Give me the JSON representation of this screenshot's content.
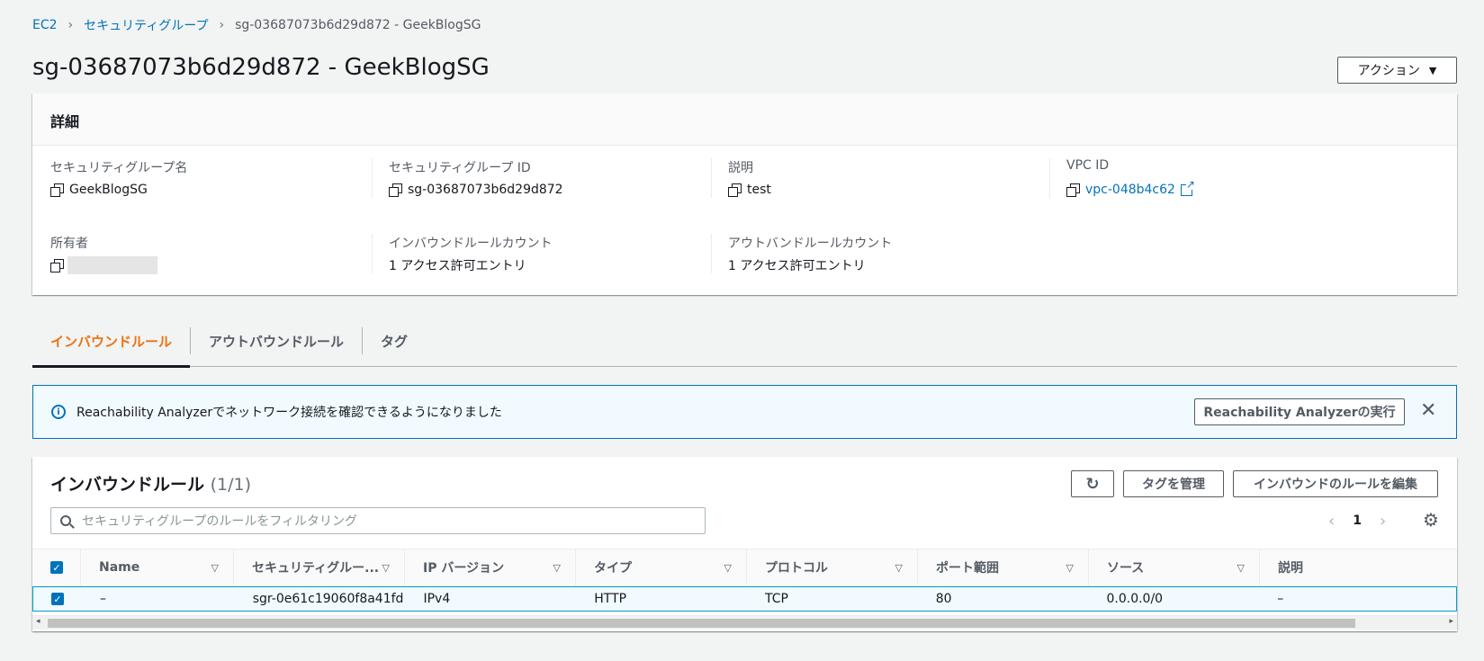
{
  "breadcrumb": {
    "root": "EC2",
    "parent": "セキュリティグループ",
    "current": "sg-03687073b6d29d872 - GeekBlogSG"
  },
  "page": {
    "title": "sg-03687073b6d29d872 - GeekBlogSG",
    "action_label": "アクション"
  },
  "details": {
    "heading": "詳細",
    "fields": [
      {
        "key": "セキュリティグループ名",
        "value": "GeekBlogSG"
      },
      {
        "key": "セキュリティグループ ID",
        "value": "sg-03687073b6d29d872"
      },
      {
        "key": "説明",
        "value": "test"
      },
      {
        "key": "VPC ID",
        "value": "vpc-048b4c62"
      },
      {
        "key": "所有者",
        "value": ""
      },
      {
        "key": "インバウンドルールカウント",
        "value": "1 アクセス許可エントリ"
      },
      {
        "key": "アウトバンドルールカウント",
        "value": "1 アクセス許可エントリ"
      }
    ]
  },
  "tabs": [
    {
      "label": "インバウンドルール"
    },
    {
      "label": "アウトバウンドルール"
    },
    {
      "label": "タグ"
    }
  ],
  "alert": {
    "message": "Reachability Analyzerでネットワーク接続を確認できるようになりました",
    "button": "Reachability Analyzerの実行"
  },
  "rules": {
    "title": "インバウンドルール",
    "count": "(1/1)",
    "manage_tags": "タグを管理",
    "edit_rules": "インバウンドのルールを編集",
    "search_placeholder": "セキュリティグループのルールをフィルタリング",
    "page": "1",
    "columns": [
      "Name",
      "セキュリティグルー...",
      "IP バージョン",
      "タイプ",
      "プロトコル",
      "ポート範囲",
      "ソース",
      "説明"
    ],
    "rows": [
      [
        "–",
        "sgr-0e61c19060f8a41fd",
        "IPv4",
        "HTTP",
        "TCP",
        "80",
        "0.0.0.0/0",
        "–"
      ]
    ]
  },
  "colors": {
    "accent": "#ec7211",
    "link": "#0073bb",
    "info_bg": "#f1faff"
  }
}
